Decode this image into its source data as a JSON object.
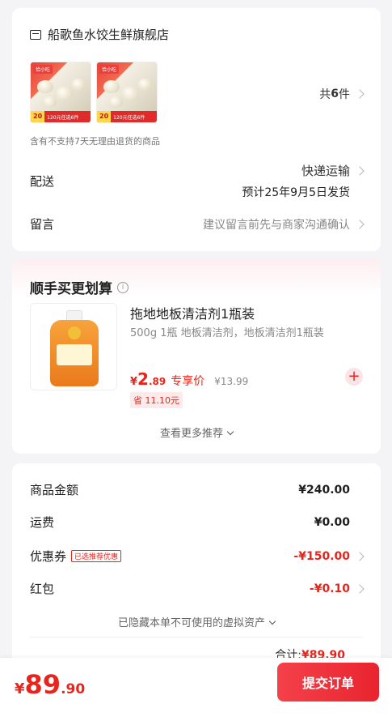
{
  "store": {
    "name": "船歌鱼水饺生鲜旗舰店",
    "thumb_tag": "恰小吃",
    "thumb_price": "20",
    "thumb_promo": "120元任选6件",
    "count_prefix": "共",
    "count_number": "6",
    "count_suffix": "件",
    "notice": "含有不支持7天无理由退货的商品",
    "shipping_label": "配送",
    "shipping_method": "快递运输",
    "shipping_date": "预计25年9月5日发货",
    "message_label": "留言",
    "message_hint": "建议留言前先与商家沟通确认"
  },
  "upsell": {
    "title": "顺手买更划算",
    "info_icon": "i",
    "product_title": "拖地地板清洁剂1瓶装",
    "product_subtitle": "500g 1瓶 地板清洁剂，地板清洁剂1瓶装",
    "price_currency": "¥",
    "price_int": "2",
    "price_dec": ".89",
    "exclusive_label": "专享价",
    "original_price": "¥13.99",
    "save_badge": "省 11.10元",
    "add_label": "+",
    "more_label": "查看更多推荐"
  },
  "summary": {
    "rows": [
      {
        "label": "商品金额",
        "value": "¥240.00"
      },
      {
        "label": "运费",
        "value": "¥0.00"
      },
      {
        "label": "优惠券",
        "tag": "已选推荐优惠",
        "value": "-¥150.00"
      },
      {
        "label": "红包",
        "value": "-¥0.10"
      }
    ],
    "hidden_assets": "已隐藏本单不可使用的虚拟资产",
    "total_label": "合计:",
    "total_value": "¥89.90"
  },
  "bottom": {
    "currency": "¥",
    "price_int": "89",
    "price_dec": ".90",
    "submit_label": "提交订单"
  },
  "colors": {
    "accent": "#e8241c",
    "background": "#f4f4f6"
  }
}
